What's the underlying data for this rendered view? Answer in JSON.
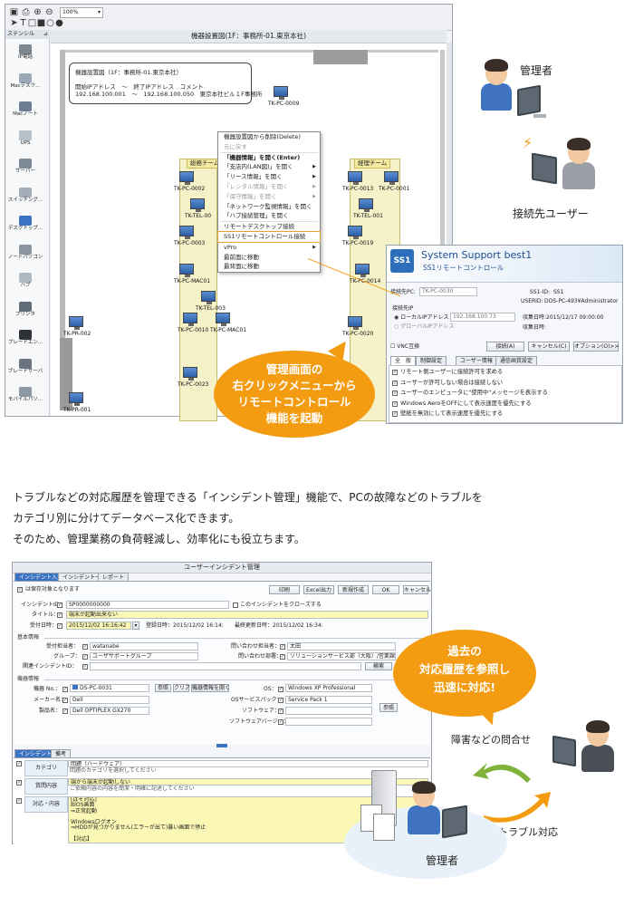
{
  "top_app": {
    "toolbar": {
      "zoom": "100%"
    },
    "stencil": {
      "title": "ステンシル",
      "items": [
        "IP電話",
        "Macデスク...",
        "Macノート",
        "UPS",
        "サーバー",
        "スイッチング...",
        "デスクトップ...",
        "ノートパソコン",
        "ハブ",
        "プリンタ",
        "ブレードエン...",
        "ブレードサーバ",
        "モバイルパソ..."
      ]
    },
    "diagram_title": "機器設置図(1F：事務所-01.東京本社)",
    "info_box": {
      "line1": "機器設置図（1F：事務所-01.東京本社）",
      "line2": "開始IPアドレス　～　終了IPアドレス　コメント",
      "line3": "192.168.100.001　～　192.168.100.050　東京本社ビル１F事務所"
    },
    "zone_left": "総務チーム",
    "zone_right": "経理チーム",
    "devices": [
      "TK-PC-0009",
      "TK-PC-0002",
      "TK-TEL-00",
      "TK-PC-0003",
      "TK-PC-MAC01",
      "TK-TEL-003",
      "TK-PC-0010",
      "TK-PC-MAC01",
      "TK-PC-0023",
      "TK-PR-002",
      "TK-PR-001",
      "TK-PC-0013",
      "TK-PC-0001",
      "TK-TEL-001",
      "TK-PC-0019",
      "TK-PC-0014",
      "TK-PC-0020"
    ],
    "context_menu": [
      {
        "label": "機器設置図から削除(Delete)",
        "disabled": false,
        "arrow": false
      },
      {
        "label": "元に戻す",
        "disabled": true,
        "arrow": false
      },
      {
        "label": "「機器情報」を開く(Enter)",
        "disabled": false,
        "arrow": false,
        "bold": true
      },
      {
        "label": "「支店内(LAN図)」を開く",
        "disabled": false,
        "arrow": true
      },
      {
        "label": "「リース情報」を開く",
        "disabled": false,
        "arrow": true
      },
      {
        "label": "「レンタル情報」を開く",
        "disabled": true,
        "arrow": true
      },
      {
        "label": "「保守情報」を開く",
        "disabled": true,
        "arrow": true
      },
      {
        "label": "「ネットワーク監視情報」を開く",
        "disabled": false,
        "arrow": false
      },
      {
        "label": "「ハブ接続管理」を開く",
        "disabled": false,
        "arrow": false
      },
      {
        "label": "リモートデスクトップ接続",
        "disabled": false,
        "arrow": false
      },
      {
        "label": "SS1リモートコントロール接続",
        "disabled": false,
        "arrow": false,
        "highlight": true
      },
      {
        "label": "vPro",
        "disabled": false,
        "arrow": true
      },
      {
        "label": "最前面に移動",
        "disabled": false,
        "arrow": false
      },
      {
        "label": "最背面に移動",
        "disabled": false,
        "arrow": false
      }
    ]
  },
  "callout_top": {
    "line1": "管理画面の",
    "line2": "右クリックメニューから",
    "line3": "リモートコントロール",
    "line4": "機能を起動"
  },
  "people_top": {
    "admin_label": "管理者",
    "user_label": "接続先ユーザー"
  },
  "ss1_popup": {
    "brand": "System Support best1",
    "subtitle": "SS1リモートコントロール",
    "logo": "SS1",
    "target_pc_label": "接続先PC:",
    "target_pc_value": "TK-PC-0030",
    "ss1id_label": "SS1-ID:",
    "ss1id_value": "SS1",
    "userid_label": "USERID:",
    "userid_value": "DOS-PC-493¥Administrator",
    "conn_label": "接続先IP",
    "local_ip_label": "ローカルIPアドレス",
    "local_ip_value": "192.168.100.73",
    "global_ip_label": "グローバルIPアドレス",
    "collect_label1": "収集日時:",
    "collect_value1": "2015/12/17 09:00:00",
    "collect_label2": "収集日時:",
    "vnc_label": "VNC互換",
    "connect_btn": "接続(A)",
    "cancel_btn": "キャンセル(C)",
    "option_btn": "オプション(O)>>",
    "tabs": [
      "全　般",
      "制御設定",
      "ユーザー情報",
      "通信画質設定"
    ],
    "options": [
      "リモート側ユーザーに接続許可を求める",
      "ユーザーが許可しない場合は接続しない",
      "ユーザーのエンピュータに\"使用中\"メッセージを表示する",
      "Windows AeroをOFFにして表示速度を優先にする",
      "壁紙を無効にして表示速度を優先にする"
    ]
  },
  "paragraph": {
    "line1": "トラブルなどの対応履歴を管理できる「インシデント管理」機能で、PCの故障などのトラブルを",
    "line2": "カテゴリ別に分けてデータベース化できます。",
    "line3": "そのため、管理業務の負荷軽減し、効率化にも役立ちます。"
  },
  "incident_app": {
    "title": "ユーザーインシデント管理",
    "tabs": [
      "インシデント入力",
      "インシデント一覧",
      "レポート"
    ],
    "unsaved_label": "は保存対象となります",
    "buttons": [
      "印刷",
      "Excel出力",
      "新規作成",
      "OK",
      "キャンセル"
    ],
    "incident_id_label": "インシデントID：",
    "incident_id_value": "SP0000000000",
    "close_label": "このインシデントをクローズする",
    "title_label": "タイトル：",
    "title_value": "端末が起動出来ない",
    "date_label": "受付日時：",
    "date_value": "2015/12/02 16:16:42",
    "registered_label": "登録日時：",
    "registered_value": "2015/12/02 16:14:",
    "updated_label": "最終更新日時：",
    "updated_value": "2015/12/02 16:34:",
    "basic_section": "基本情報",
    "receiver_label": "受付担当者：",
    "receiver_value": "watanabe",
    "group_label": "グループ：",
    "group_value": "ユーザサポートグループ",
    "related_label": "関連インシデントID：",
    "inquirer_label": "問い合わせ担当者：",
    "inquirer_value": "太田",
    "inquiry_dept_label": "問い合わせ部署：",
    "inquiry_dept_value": "ソリューションサービス部（大阪）/営業課",
    "search_btn": "検索",
    "device_section": "機器情報",
    "device_no_label": "機器 No.：",
    "device_no_value": "DS-PC-0031",
    "ref_btn": "参照",
    "clear_btn": "クリア",
    "device_info_btn": "機器情報を開く",
    "maker_label": "メーカー名：",
    "maker_value": "Dell",
    "model_label": "製品名：",
    "model_value": "Dell OPTIPLEX GX270",
    "os_label": "OS：",
    "os_value": "Windows XP Professional",
    "sp_label": "OSサービスパック：",
    "sp_value": "Service Pack 1",
    "software_label": "ソフトウェア：",
    "software_version_label": "ソフトウェアバージョン：",
    "ref_btn2": "参照",
    "bottom_tabs": [
      "インシデント",
      "備考"
    ],
    "category_label": "カテゴリ",
    "category_value": "問題（ハードウェア）",
    "category_hint": "問題のカテゴリを選択してください",
    "inquiry_label": "質問内容",
    "inquiry_value": "端から端末が起動しない",
    "inquiry_hint": "ご依頼内容の内容を簡潔・明確に記述してください",
    "response_label": "対応・内容",
    "response_lines": [
      "[ばそ対応]",
      "BIOS画面",
      "⇒正常起動",
      "",
      "Windowsログオン",
      "⇒HDDが見つかりません(エラーが出て)暴い画面で停止",
      "",
      "【対応】"
    ]
  },
  "callout_bottom": {
    "line1": "過去の",
    "line2": "対応履歴を参照し",
    "line3": "迅速に対応!"
  },
  "people_bottom": {
    "inquiry_label": "障害などの問合せ",
    "response_label": "トラブル対応",
    "admin_label": "管理者"
  }
}
